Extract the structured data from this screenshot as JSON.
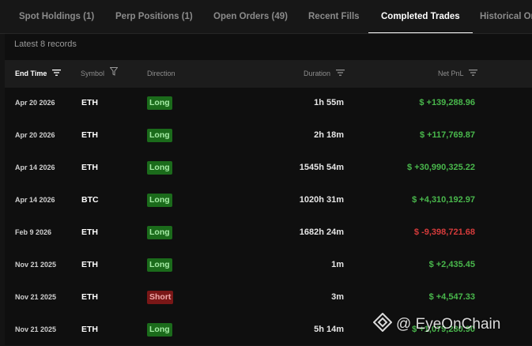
{
  "tabs": [
    {
      "label": "Spot Holdings (1)",
      "active": false
    },
    {
      "label": "Perp Positions (1)",
      "active": false
    },
    {
      "label": "Open Orders (49)",
      "active": false
    },
    {
      "label": "Recent Fills",
      "active": false
    },
    {
      "label": "Completed Trades",
      "active": true
    },
    {
      "label": "Historical Ord",
      "active": false
    }
  ],
  "records_label": "Latest 8 records",
  "columns": {
    "end_time": "End Time",
    "symbol": "Symbol",
    "direction": "Direction",
    "duration": "Duration",
    "net_pnl": "Net PnL"
  },
  "rows": [
    {
      "end_time": "Apr 20 2026",
      "symbol": "ETH",
      "direction": "Long",
      "duration": "1h 55m",
      "net_pnl": "$ +139,288.96",
      "pnl_sign": "pos"
    },
    {
      "end_time": "Apr 20 2026",
      "symbol": "ETH",
      "direction": "Long",
      "duration": "2h 18m",
      "net_pnl": "$ +117,769.87",
      "pnl_sign": "pos"
    },
    {
      "end_time": "Apr 14 2026",
      "symbol": "ETH",
      "direction": "Long",
      "duration": "1545h 54m",
      "net_pnl": "$ +30,990,325.22",
      "pnl_sign": "pos"
    },
    {
      "end_time": "Apr 14 2026",
      "symbol": "BTC",
      "direction": "Long",
      "duration": "1020h 31m",
      "net_pnl": "$ +4,310,192.97",
      "pnl_sign": "pos"
    },
    {
      "end_time": "Feb 9 2026",
      "symbol": "ETH",
      "direction": "Long",
      "duration": "1682h 24m",
      "net_pnl": "$ -9,398,721.68",
      "pnl_sign": "neg"
    },
    {
      "end_time": "Nov 21 2025",
      "symbol": "ETH",
      "direction": "Long",
      "duration": "1m",
      "net_pnl": "$ +2,435.45",
      "pnl_sign": "pos"
    },
    {
      "end_time": "Nov 21 2025",
      "symbol": "ETH",
      "direction": "Short",
      "duration": "3m",
      "net_pnl": "$ +4,547.33",
      "pnl_sign": "pos"
    },
    {
      "end_time": "Nov 21 2025",
      "symbol": "ETH",
      "direction": "Long",
      "duration": "5h 14m",
      "net_pnl": "$ +1,079,280.90",
      "pnl_sign": "pos"
    }
  ],
  "watermark": "@ EyeOnChain",
  "colors": {
    "positive": "#49b84c",
    "negative": "#d63b3b",
    "long_badge": "#1b6b1b",
    "short_badge": "#7a1717",
    "background": "#141414"
  },
  "icons": {
    "sort": "sort-lines-icon",
    "filter": "filter-funnel-icon",
    "watermark_logo": "diamond-logo-icon"
  }
}
